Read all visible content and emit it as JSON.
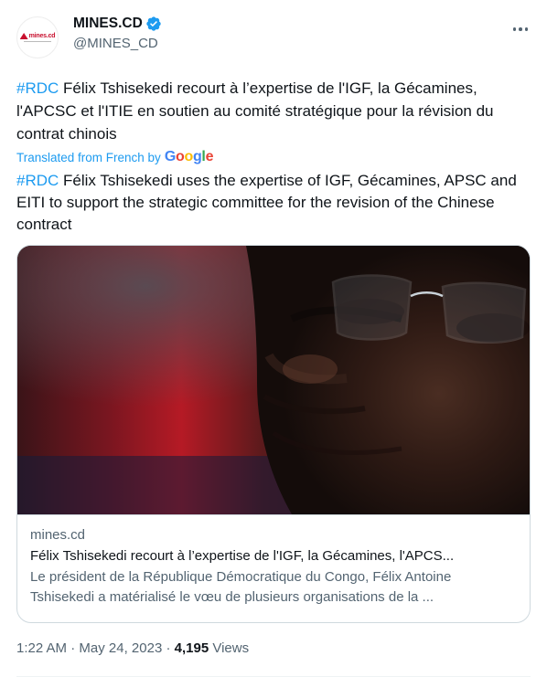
{
  "author": {
    "display_name": "MINES.CD",
    "handle": "@MINES_CD",
    "avatar_logo_text": "mines.cd",
    "verified": true
  },
  "tweet": {
    "hashtag": "#RDC",
    "original_text": " Félix Tshisekedi recourt à l’expertise de l'IGF, la Gécamines, l'APCSC et l'ITIE en soutien au comité stratégique pour la révision du contrat chinois",
    "translated_label": "Translated from French by",
    "translated_provider": "Google",
    "translated_hashtag": "#RDC",
    "translated_text": " Félix Tshisekedi uses the expertise of IGF, Gécamines, APSC and EITI to support the strategic committee for the revision of the Chinese contract"
  },
  "card": {
    "domain": "mines.cd",
    "title": "Félix Tshisekedi recourt à l’expertise de l'IGF, la Gécamines, l'APCS...",
    "description": "Le président de la République Démocratique du Congo, Félix Antoine Tshisekedi a matérialisé le vœu de plusieurs organisations de la ...",
    "image_icon": "portrait-photo"
  },
  "meta": {
    "time": "1:22 AM",
    "separator": "·",
    "date": "May 24, 2023",
    "views_count": "4,195",
    "views_label": "Views"
  },
  "colors": {
    "accent": "#1d9bf0",
    "text": "#0f1419",
    "muted": "#536471",
    "border": "#cfd9de"
  }
}
